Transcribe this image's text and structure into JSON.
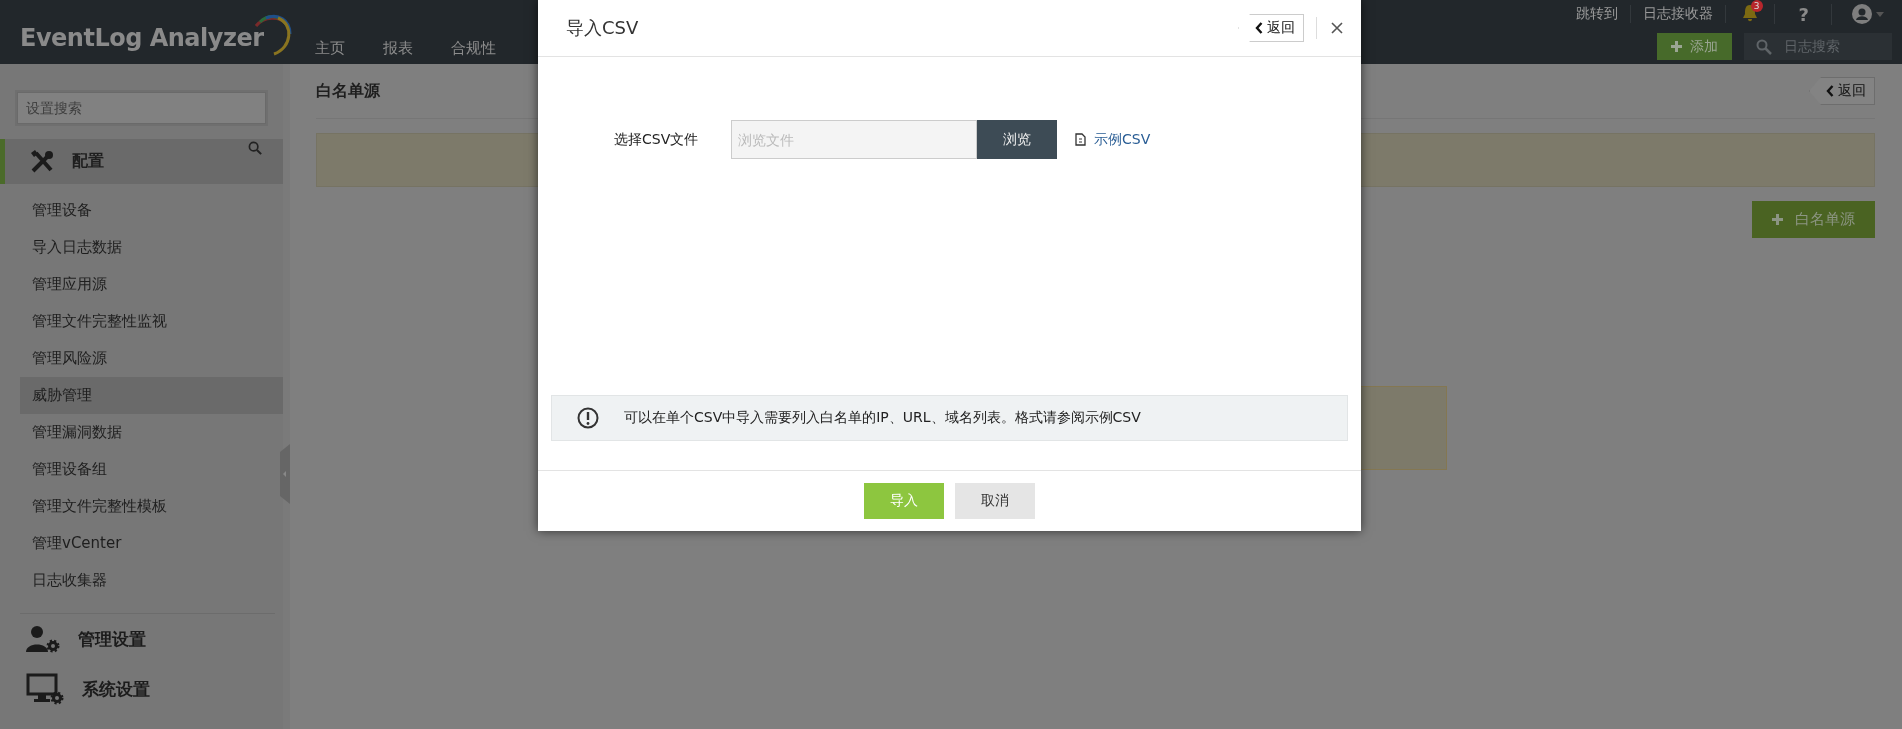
{
  "header": {
    "logo": "EventLog Analyzer",
    "nav": [
      "主页",
      "报表",
      "合规性"
    ],
    "top_links": [
      "跳转到",
      "日志接收器"
    ],
    "notification_count": "3",
    "help": "?",
    "add_button": "添加",
    "search": {
      "placeholder": "日志搜索"
    }
  },
  "sidebar": {
    "search": {
      "placeholder": "设置搜索"
    },
    "section": {
      "title": "配置",
      "selected": true
    },
    "items": [
      {
        "label": "管理设备",
        "selected": false
      },
      {
        "label": "导入日志数据",
        "selected": false
      },
      {
        "label": "管理应用源",
        "selected": false
      },
      {
        "label": "管理文件完整性监视",
        "selected": false
      },
      {
        "label": "管理风险源",
        "selected": false
      },
      {
        "label": "威胁管理",
        "selected": true
      },
      {
        "label": "管理漏洞数据",
        "selected": false
      },
      {
        "label": "管理设备组",
        "selected": false
      },
      {
        "label": "管理文件完整性模板",
        "selected": false
      },
      {
        "label": "管理vCenter",
        "selected": false
      },
      {
        "label": "日志收集器",
        "selected": false
      }
    ],
    "groups": [
      {
        "kind": "admin",
        "title": "管理设置"
      },
      {
        "kind": "system",
        "title": "系统设置"
      }
    ]
  },
  "main": {
    "title": "白名单源",
    "back_button": "返回",
    "add_button": "白名单源"
  },
  "modal": {
    "title": "导入CSV",
    "back_button": "返回",
    "file_label": "选择CSV文件",
    "file_field": {
      "placeholder": "浏览文件"
    },
    "browse_button": "浏览",
    "sample_link": "示例CSV",
    "info": "可以在单个CSV中导入需要列入白名单的IP、URL、域名列表。格式请参阅示例CSV",
    "import_button": "导入",
    "cancel_button": "取消"
  }
}
